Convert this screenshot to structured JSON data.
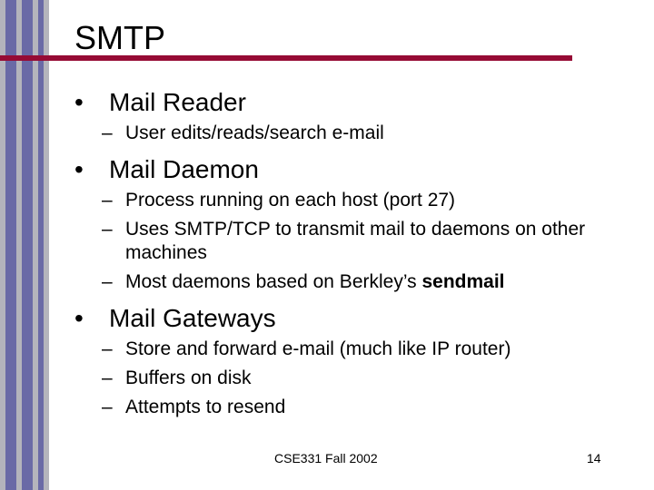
{
  "slide": {
    "title": "SMTP",
    "sections": [
      {
        "heading": "Mail Reader",
        "items": [
          "User edits/reads/search e-mail"
        ]
      },
      {
        "heading": "Mail Daemon",
        "items": [
          "Process running on each host (port 27)",
          "Uses SMTP/TCP to transmit mail to daemons on other machines",
          {
            "text": "Most daemons based on Berkley’s ",
            "bold": "sendmail"
          }
        ]
      },
      {
        "heading": "Mail Gateways",
        "items": [
          "Store and forward e-mail (much like IP router)",
          "Buffers on disk",
          "Attempts to resend"
        ]
      }
    ],
    "bullet_glyph": "•",
    "dash_glyph": "–",
    "footer": {
      "center": "CSE331 Fall 2002",
      "page_number": "14"
    },
    "colors": {
      "rule": "#960b35",
      "stripe_blue": "#6a6aa6",
      "stripe_gray": "#b4b4bc"
    }
  }
}
